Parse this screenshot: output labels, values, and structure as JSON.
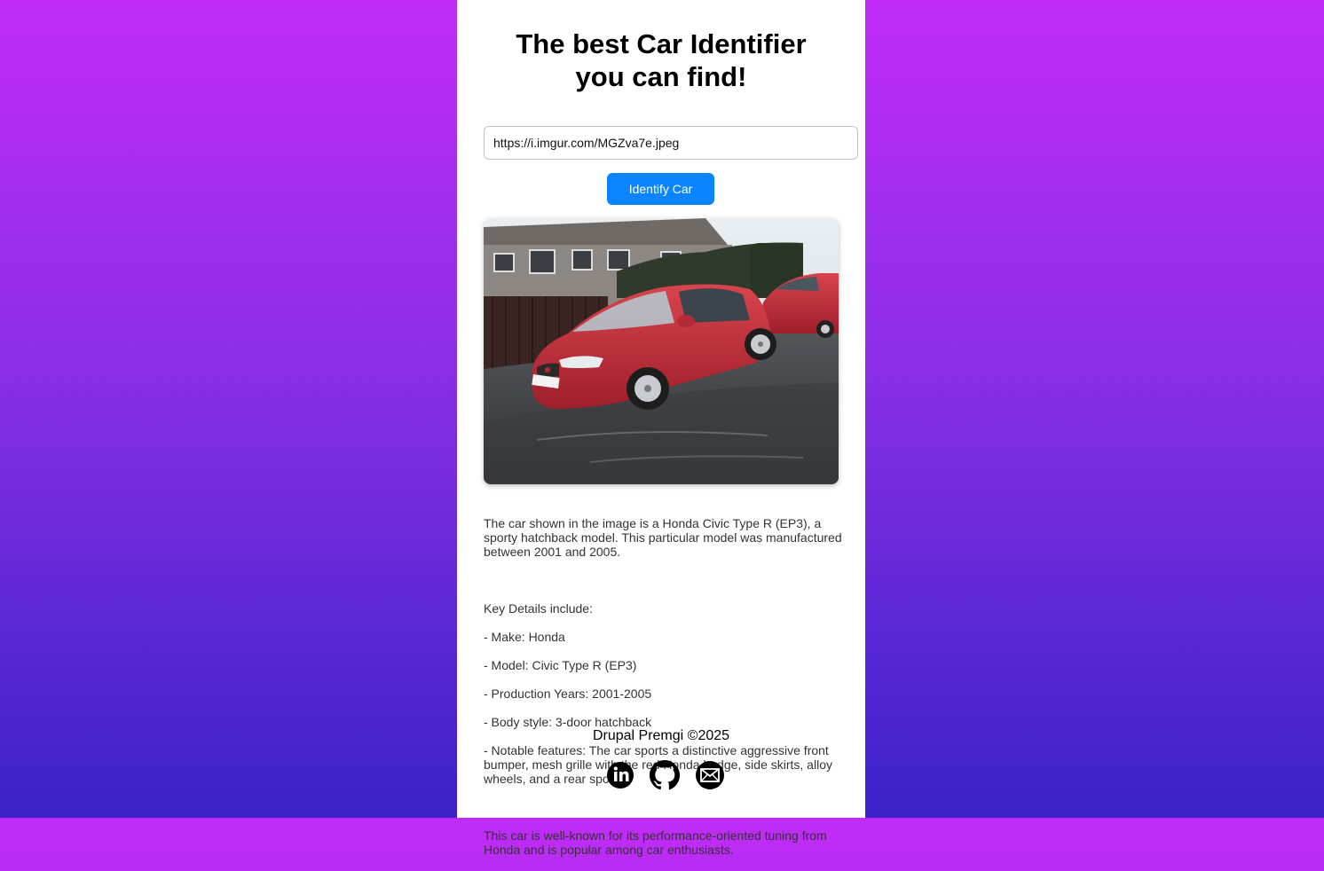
{
  "header": {
    "title_line1": "The best Car Identifier",
    "title_line2": "you can find!"
  },
  "form": {
    "url_value": "https://i.imgur.com/MGZva7e.jpeg",
    "identify_label": "Identify Car"
  },
  "result": {
    "paragraph1": "The car shown in the image is a Honda Civic Type R (EP3), a sporty hatchback model. This particular model was manufactured between 2001 and 2005.",
    "details_heading": "Key Details include:",
    "details": [
      "- Make: Honda",
      "- Model: Civic Type R (EP3)",
      "- Production Years: 2001-2005",
      "- Body style: 3-door hatchback",
      "- Notable features: The car sports a distinctive aggressive front bumper, mesh grille with the red Honda badge, side skirts, alloy wheels, and a rear spoiler."
    ],
    "paragraph3": "This car is well-known for its performance-oriented tuning from Honda and is popular among car enthusiasts."
  },
  "footer": {
    "credit": "Drupal Premgi ©2025",
    "icons": [
      "linkedin-icon",
      "github-icon",
      "email-icon"
    ]
  },
  "colors": {
    "accent": "#0a84ff",
    "gradient_top": "#c02cf6",
    "gradient_bottom": "#3a22c8"
  }
}
